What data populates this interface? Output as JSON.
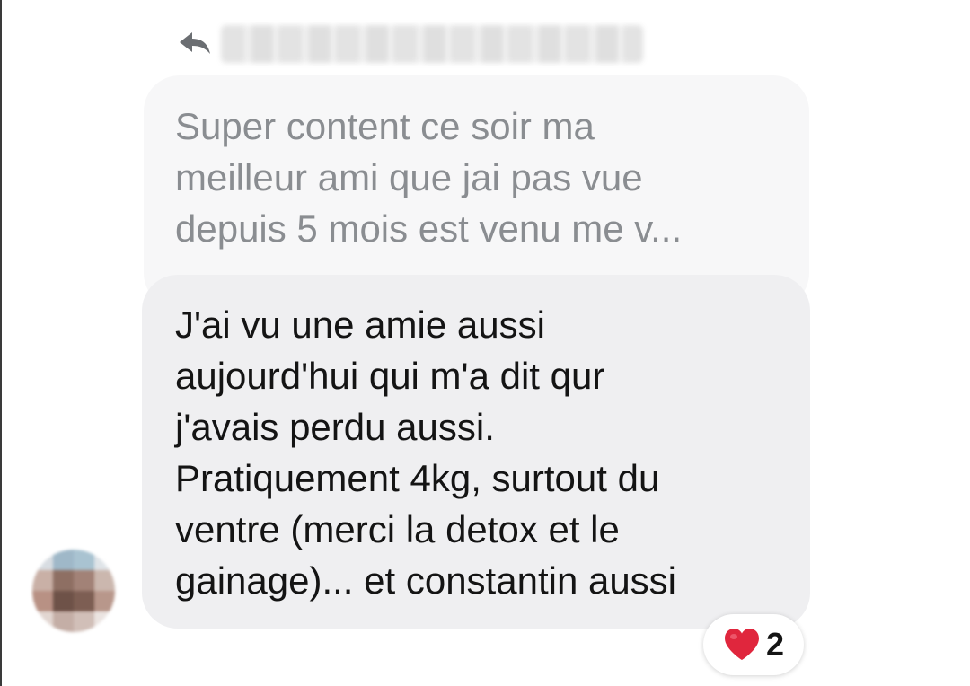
{
  "reply": {
    "icon": "reply-arrow-icon",
    "quoted_message": "Super content ce soir ma\nmeilleur ami que jai pas vue\ndepuis 5 mois est venu me v..."
  },
  "message": {
    "text": "J'ai vu une amie aussi\naujourd'hui qui m'a dit qur\nj'avais perdu aussi.\nPratiquement 4kg, surtout du\nventre (merci la detox et le\ngainage)... et constantin aussi"
  },
  "reaction": {
    "icon": "heart-icon",
    "count": "2"
  },
  "colors": {
    "bubble": "#efeff1",
    "quoted_bubble": "#f7f7f8",
    "quoted_text": "#8a8d91",
    "heart": "#e0263d"
  }
}
